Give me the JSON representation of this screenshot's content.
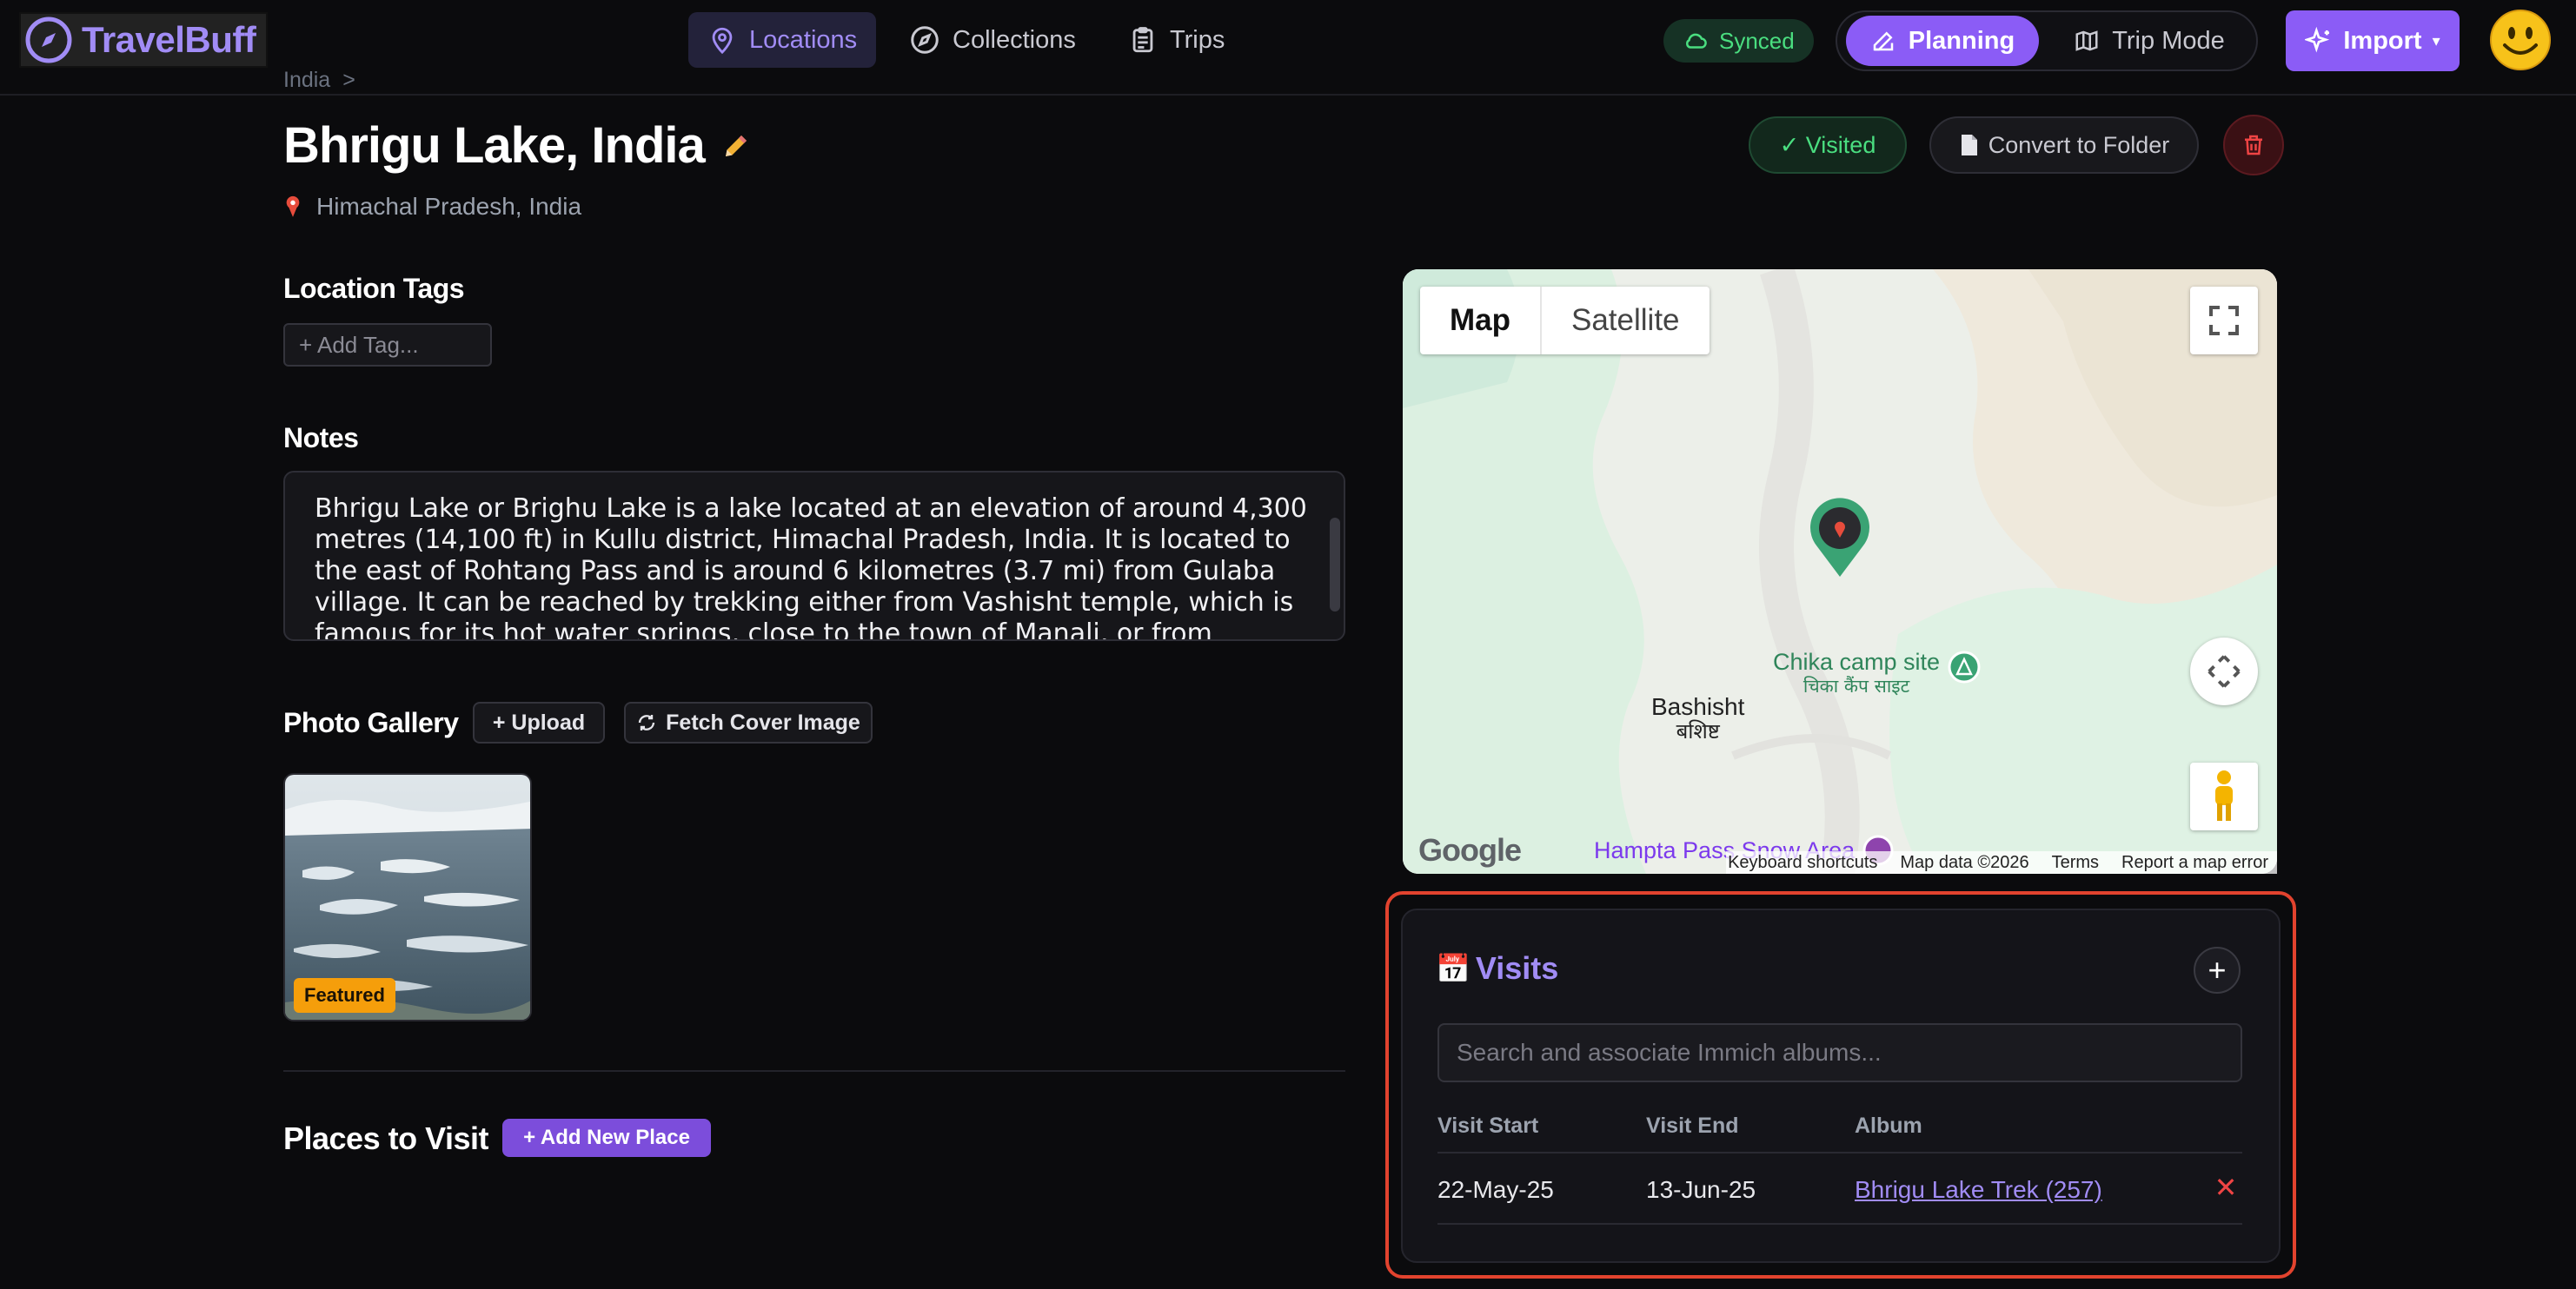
{
  "app": {
    "name": "TravelBuff"
  },
  "nav": {
    "items": [
      {
        "label": "Locations",
        "icon": "map-pin-icon",
        "active": true
      },
      {
        "label": "Collections",
        "icon": "compass-icon",
        "active": false
      },
      {
        "label": "Trips",
        "icon": "clipboard-icon",
        "active": false
      }
    ],
    "synced_label": "Synced",
    "planning_label": "Planning",
    "trip_mode_label": "Trip Mode",
    "import_label": "Import",
    "import_caret": "▾"
  },
  "location": {
    "breadcrumb": [
      "India",
      ">"
    ],
    "title": "Bhrigu Lake, India",
    "region": "Himachal Pradesh, India",
    "visited_label": "✓ Visited",
    "convert_label": "Convert to Folder"
  },
  "tags": {
    "heading": "Location Tags",
    "add_label": "+ Add Tag..."
  },
  "notes": {
    "heading": "Notes",
    "text": "Bhrigu Lake or Brighu Lake is a lake located at an elevation of around 4,300 metres (14,100 ft) in Kullu district, Himachal Pradesh, India. It is located to the east of Rohtang Pass and is around 6 kilometres (3.7 mi) from Gulaba village. It can be reached by trekking either from Vashisht temple, which is famous for its hot water springs, close to the town of Manali, or from Gulaba, on the way to"
  },
  "gallery": {
    "heading": "Photo Gallery",
    "upload_label": "+ Upload",
    "fetch_label": "Fetch Cover Image",
    "featured_label": "Featured"
  },
  "places": {
    "heading": "Places to Visit",
    "add_label": "+ Add New Place"
  },
  "map": {
    "type_map": "Map",
    "type_satellite": "Satellite",
    "labels": {
      "bashisht": "Bashisht",
      "bashisht_local": "बशिष्ट",
      "chika": "Chika camp site",
      "chika_local": "चिका कैंप साइट",
      "hampta": "Hampta Pass Snow Area"
    },
    "google": "Google",
    "attribution": [
      "Keyboard shortcuts",
      "Map data ©2026",
      "Terms",
      "Report a map error"
    ]
  },
  "visits": {
    "icon": "📅",
    "title": "Visits",
    "add_symbol": "+",
    "search_placeholder": "Search and associate Immich albums...",
    "columns": [
      "Visit Start",
      "Visit End",
      "Album"
    ],
    "rows": [
      {
        "start": "22-May-25",
        "end": "13-Jun-25",
        "album": "Bhrigu Lake Trek (257)",
        "remove": "✕"
      }
    ]
  },
  "colors": {
    "accent": "#8b5cf6",
    "accent_text": "#a18cf5",
    "success": "#4ade80",
    "danger": "#ef4444",
    "highlight_border": "#e2432e",
    "featured_badge": "#f59e0b"
  }
}
